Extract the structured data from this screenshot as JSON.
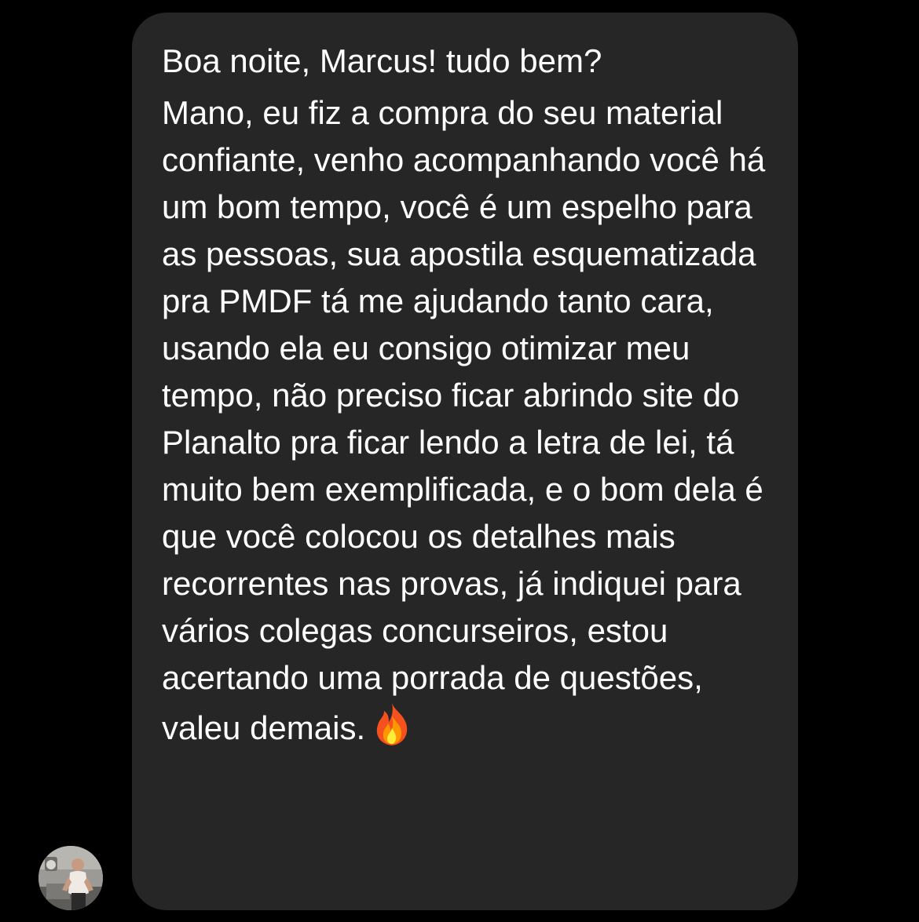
{
  "conversation": {
    "incoming_message": {
      "greeting": "Boa noite, Marcus! tudo bem?",
      "body": "Mano, eu fiz a compra do seu material confiante, venho acompanhando você há um bom tempo, você é um espelho para as pessoas, sua apostila esquematizada pra PMDF tá me ajudando tanto cara, usando ela eu consigo otimizar meu tempo, não preciso ficar abrindo site do Planalto pra ficar lendo a letra de lei, tá muito bem exemplificada, e o bom dela é que você colocou os detalhes mais recorrentes nas provas, já indiquei para vários colegas concurseiros, estou acertando uma porrada de questões, valeu demais.",
      "emoji": "fire-emoji"
    },
    "sender": {
      "avatar_icon": "profile-photo"
    }
  },
  "theme": {
    "background": "#000000",
    "bubble": "#262626",
    "text": "#ffffff"
  }
}
